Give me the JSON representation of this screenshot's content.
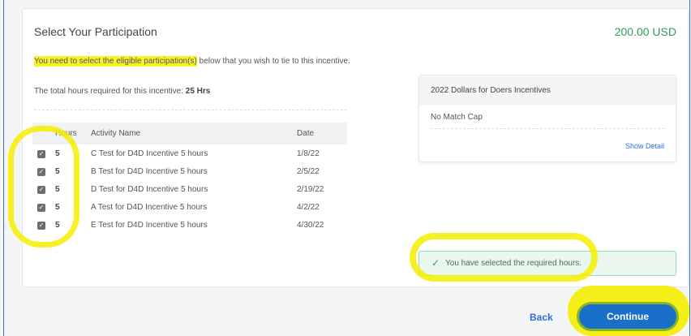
{
  "header": {
    "title": "Select Your Participation",
    "amount": "200.00 USD"
  },
  "instructions": {
    "highlighted": "You need to select the eligible participation(s)",
    "rest": " below that you wish to tie to this incentive.",
    "total_label": "The total hours required for this incentive: ",
    "total_value": "25 Hrs"
  },
  "table": {
    "columns": [
      "Hours",
      "Activity Name",
      "Date"
    ],
    "rows": [
      {
        "checked": true,
        "hours": "5",
        "name": "C Test for D4D Incentive 5 hours",
        "date": "1/8/22"
      },
      {
        "checked": true,
        "hours": "5",
        "name": "B Test for D4D Incentive 5 hours",
        "date": "2/5/22"
      },
      {
        "checked": true,
        "hours": "5",
        "name": "D Test for D4D Incentive 5 hours",
        "date": "2/19/22"
      },
      {
        "checked": true,
        "hours": "5",
        "name": "A Test for D4D Incentive 5 hours",
        "date": "4/2/22"
      },
      {
        "checked": true,
        "hours": "5",
        "name": "E Test for D4D Incentive 5 hours",
        "date": "4/30/22"
      }
    ]
  },
  "detail": {
    "title": "2022 Dollars for Doers Incentives",
    "cap": "No Match Cap",
    "link": "Show Detail"
  },
  "success": {
    "message": "You have selected the required hours."
  },
  "footer": {
    "back": "Back",
    "continue": "Continue"
  },
  "colors": {
    "accent": "#1a6fc9",
    "success": "#2f9e5b",
    "highlight": "#f4ee00"
  }
}
